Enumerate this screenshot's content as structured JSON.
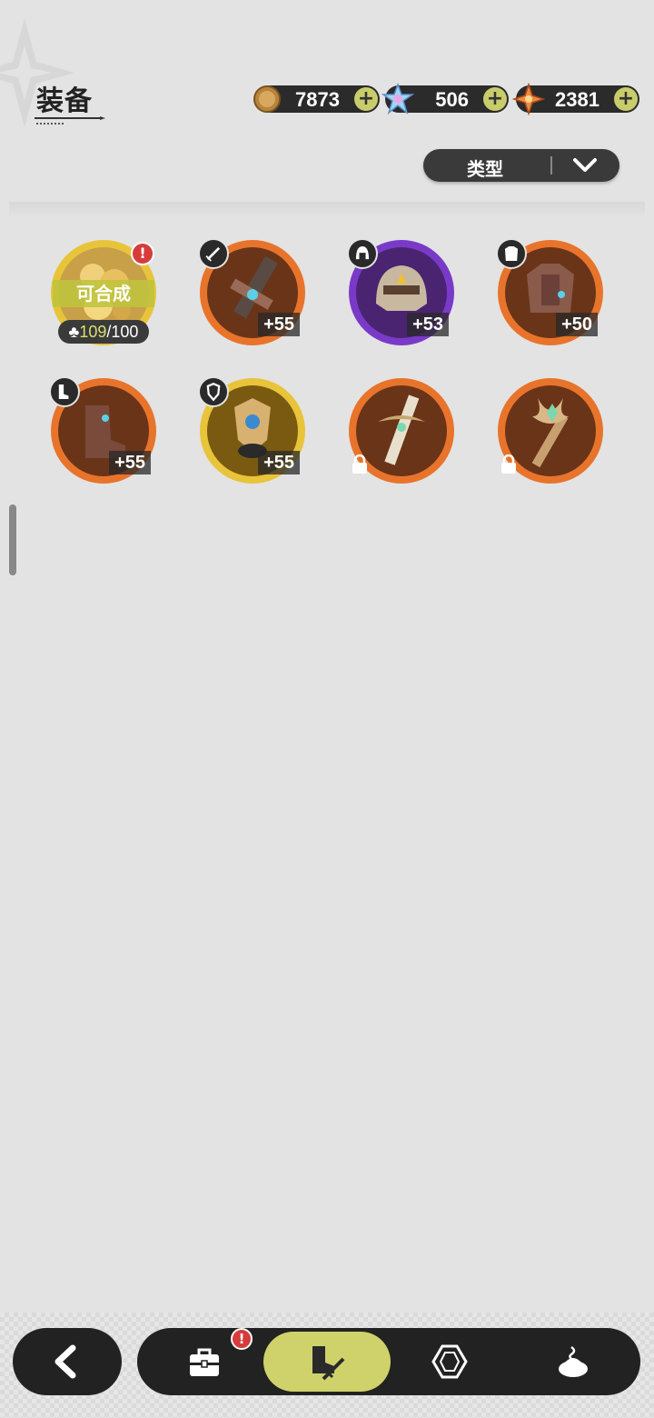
{
  "header": {
    "title": "装备"
  },
  "currencies": [
    {
      "icon": "gold-coin-icon",
      "value": "7873"
    },
    {
      "icon": "crystal-gem-icon",
      "value": "506"
    },
    {
      "icon": "orange-star-icon",
      "value": "2381"
    }
  ],
  "filter": {
    "label": "类型"
  },
  "items": [
    {
      "name": "fragment",
      "synth_label": "可合成",
      "fragments_have": "109",
      "fragments_sep_total": "/100",
      "alert": "!"
    },
    {
      "name": "sword",
      "slot_icon": "sword-icon",
      "level": "+55"
    },
    {
      "name": "helmet",
      "slot_icon": "helmet-icon",
      "level": "+53"
    },
    {
      "name": "armor",
      "slot_icon": "armor-icon",
      "level": "+50"
    },
    {
      "name": "boots",
      "slot_icon": "boots-icon",
      "level": "+55"
    },
    {
      "name": "shield",
      "slot_icon": "shield-icon",
      "level": "+55"
    },
    {
      "name": "locked-sword",
      "locked": true
    },
    {
      "name": "locked-staff",
      "locked": true
    }
  ],
  "nav": {
    "tabs": [
      "backpack",
      "equipment",
      "gem",
      "cooking"
    ],
    "active_tab": "equipment",
    "equipment_alert": "!"
  },
  "colors": {
    "background": "#e3e3e3",
    "accent": "#cfd26a",
    "orange_ring": "#e8742c",
    "gold_ring": "#e8c43a",
    "purple_ring": "#7a3ac8",
    "alert": "#d63c3c"
  }
}
